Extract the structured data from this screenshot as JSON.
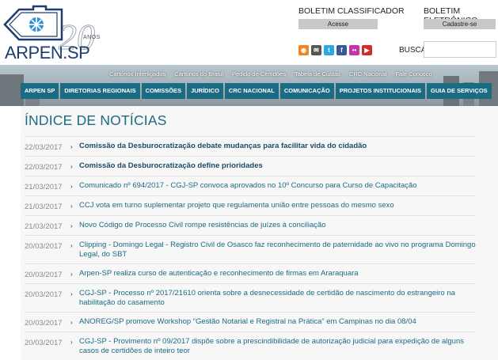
{
  "header": {
    "logo": {
      "name": "ARPEN",
      "suffix": ".SP",
      "anniversary": "20",
      "anos": "ANOS"
    },
    "boletim_classificador": {
      "label": "BOLETIM CLASSIFICADOR",
      "button": "Acesse"
    },
    "boletim_eletronico": {
      "label": "BOLETIM ELETRÔNICO",
      "button": "Cadastre-se"
    },
    "social": [
      {
        "icon": "rss-icon",
        "glyph": "◉",
        "color": "#f0841f"
      },
      {
        "icon": "email-icon",
        "glyph": "✉",
        "color": "#555555"
      },
      {
        "icon": "twitter-icon",
        "glyph": "t",
        "color": "#29a9e1"
      },
      {
        "icon": "facebook-icon",
        "glyph": "f",
        "color": "#3b5998"
      },
      {
        "icon": "flickr-icon",
        "glyph": "••",
        "color": "#c535a6"
      },
      {
        "icon": "youtube-icon",
        "glyph": "▶",
        "color": "#d62a2a"
      }
    ],
    "search": {
      "label": "BUSCA",
      "value": "",
      "placeholder": ""
    }
  },
  "toplinks": [
    "Cartórios Interligados",
    "Cartórios do Brasil",
    "Pedido de Certidões",
    "Tabela de Custas",
    "CRC Nacional",
    "Fale Conosco"
  ],
  "mainnav": [
    "ARPEN SP",
    "DIRETORIAS REGIONAIS",
    "COMISSÕES",
    "JURÍDICO",
    "CRC NACIONAL",
    "COMUNICAÇÃO",
    "PROJETOS INSTITUCIONAIS",
    "GUIA DE SERVIÇOS"
  ],
  "page": {
    "title": "ÍNDICE DE NOTÍCIAS"
  },
  "news": [
    {
      "date": "22/03/2017",
      "title": "Comissão da Desburocratização debate mudanças para facilitar vida do cidadão",
      "bold": true
    },
    {
      "date": "22/03/2017",
      "title": "Comissão da Desburocratização define prioridades",
      "bold": true
    },
    {
      "date": "21/03/2017",
      "title": "Comunicado nº 694/2017 - CGJ-SP convoca aprovados no 10º Concurso para Curso de Capacitação",
      "bold": false
    },
    {
      "date": "21/03/2017",
      "title": "CCJ vota em turno suplementar projeto que regulamenta união entre pessoas do mesmo sexo",
      "bold": false
    },
    {
      "date": "21/03/2017",
      "title": "Novo Código de Processo Civil rompe resistências de juízes à conciliação",
      "bold": false
    },
    {
      "date": "20/03/2017",
      "title": "Clipping - Domingo Legal - Registro Civil de Osasco faz reconhecimento de paternidade ao vivo no programa Domingo Legal, do SBT",
      "bold": false
    },
    {
      "date": "20/03/2017",
      "title": "Arpen-SP realiza curso de autenticação e reconhecimento de firmas em Araraquara",
      "bold": false
    },
    {
      "date": "20/03/2017",
      "title": "CGJ-SP - Processo nº 2017/21610 orienta sobre a desnecessidade de certidão de nascimento do estrangeiro na habilitação do casamento",
      "bold": false
    },
    {
      "date": "20/03/2017",
      "title": "ANOREG/SP promove Workshop “Gestão Notarial e Registral na Prática” em Campinas no dia 08/04",
      "bold": false
    },
    {
      "date": "20/03/2017",
      "title": "CGJ-SP - Provimento nº 09/2017 dispõe sobre a prescindibilidade de autorização judicial para expedição de alguns casos de certidões de inteiro teor",
      "bold": false
    }
  ]
}
